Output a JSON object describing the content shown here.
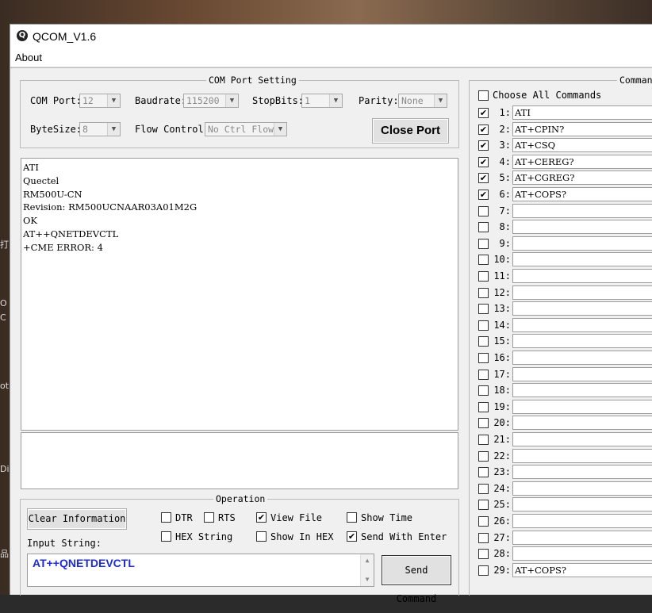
{
  "window": {
    "title": "QCOM_V1.6",
    "logo": "Q"
  },
  "menu": {
    "about": "About"
  },
  "desktop": {
    "icon_labels": [
      "打",
      "O",
      "C",
      "ot",
      "Dis",
      "品"
    ]
  },
  "com_port_setting": {
    "legend": "COM Port Setting",
    "com_port_label": "COM Port:",
    "com_port_value": "12",
    "baudrate_label": "Baudrate:",
    "baudrate_value": "115200",
    "stopbits_label": "StopBits:",
    "stopbits_value": "1",
    "parity_label": "Parity:",
    "parity_value": "None",
    "bytesize_label": "ByteSize:",
    "bytesize_value": "8",
    "flow_control_label": "Flow Control:",
    "flow_control_value": "No Ctrl Flow",
    "close_port_label": "Close Port"
  },
  "log": {
    "lines": [
      "ATI",
      "Quectel",
      "RM500U-CN",
      "Revision: RM500UCNAAR03A01M2G",
      "",
      "OK",
      "AT++QNETDEVCTL",
      "+CME ERROR: 4"
    ]
  },
  "operation": {
    "legend": "Operation",
    "clear_info_label": "Clear Information",
    "dtr_label": "DTR",
    "dtr_checked": false,
    "rts_label": "RTS",
    "rts_checked": false,
    "view_file_label": "View File",
    "view_file_checked": true,
    "show_time_label": "Show Time",
    "show_time_checked": false,
    "hex_string_label": "HEX String",
    "hex_string_checked": false,
    "show_in_hex_label": "Show In HEX",
    "show_in_hex_checked": false,
    "send_with_enter_label": "Send With Enter",
    "send_with_enter_checked": true,
    "input_string_label": "Input String:",
    "input_string_value": "AT++QNETDEVCTL",
    "send_command_label": "Send Command"
  },
  "commands": {
    "legend": "Command",
    "choose_all_label": "Choose All Commands",
    "choose_all_checked": false,
    "items": [
      {
        "num": "1:",
        "value": "ATI",
        "checked": true
      },
      {
        "num": "2:",
        "value": "AT+CPIN?",
        "checked": true
      },
      {
        "num": "3:",
        "value": "AT+CSQ",
        "checked": true
      },
      {
        "num": "4:",
        "value": "AT+CEREG?",
        "checked": true
      },
      {
        "num": "5:",
        "value": "AT+CGREG?",
        "checked": true
      },
      {
        "num": "6:",
        "value": "AT+COPS?",
        "checked": true
      },
      {
        "num": "7:",
        "value": "",
        "checked": false
      },
      {
        "num": "8:",
        "value": "",
        "checked": false
      },
      {
        "num": "9:",
        "value": "",
        "checked": false
      },
      {
        "num": "10:",
        "value": "",
        "checked": false
      },
      {
        "num": "11:",
        "value": "",
        "checked": false
      },
      {
        "num": "12:",
        "value": "",
        "checked": false
      },
      {
        "num": "13:",
        "value": "",
        "checked": false
      },
      {
        "num": "14:",
        "value": "",
        "checked": false
      },
      {
        "num": "15:",
        "value": "",
        "checked": false
      },
      {
        "num": "16:",
        "value": "",
        "checked": false
      },
      {
        "num": "17:",
        "value": "",
        "checked": false
      },
      {
        "num": "18:",
        "value": "",
        "checked": false
      },
      {
        "num": "19:",
        "value": "",
        "checked": false
      },
      {
        "num": "20:",
        "value": "",
        "checked": false
      },
      {
        "num": "21:",
        "value": "",
        "checked": false
      },
      {
        "num": "22:",
        "value": "",
        "checked": false
      },
      {
        "num": "23:",
        "value": "",
        "checked": false
      },
      {
        "num": "24:",
        "value": "",
        "checked": false
      },
      {
        "num": "25:",
        "value": "",
        "checked": false
      },
      {
        "num": "26:",
        "value": "",
        "checked": false
      },
      {
        "num": "27:",
        "value": "",
        "checked": false
      },
      {
        "num": "28:",
        "value": "",
        "checked": false
      },
      {
        "num": "29:",
        "value": "AT+COPS?",
        "checked": false
      }
    ]
  }
}
